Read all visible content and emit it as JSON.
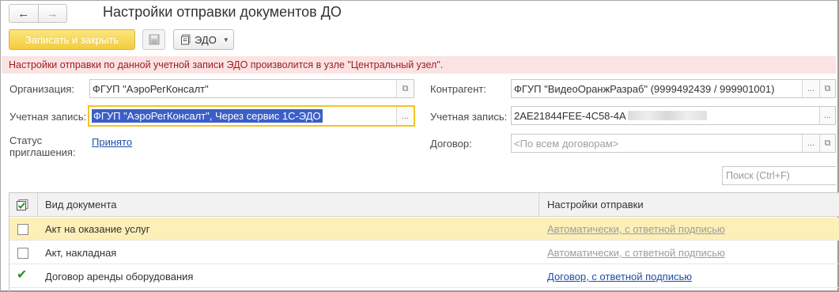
{
  "header": {
    "title": "Настройки отправки документов ДО",
    "nav": {
      "back_icon": "arrow-left-icon",
      "forward_icon": "arrow-right-icon"
    }
  },
  "toolbar": {
    "save_close_label": "Записать и закрыть",
    "save_icon": "floppy-disk-icon",
    "edo_label": "ЭДО",
    "edo_icon": "document-stack-icon"
  },
  "info_message": "Настройки отправки по данной учетной записи ЭДО произволится в узле \"Центральный узел\".",
  "left": {
    "org_label": "Организация:",
    "org_value": "ФГУП \"АэроРегКонсалт\"",
    "account_label": "Учетная запись:",
    "account_value": "ФГУП \"АэроРегКонсалт\", Через сервис 1С-ЭДО",
    "status_label_1": "Статус",
    "status_label_2": "приглашения:",
    "status_value": "Принято"
  },
  "right": {
    "counterparty_label": "Контрагент:",
    "counterparty_value": "ФГУП \"ВидеоОранжРазраб\" (9999492439 / 999901001)",
    "account_label": "Учетная запись:",
    "account_value": "2AE21844FEE-4C58-4A",
    "contract_label": "Договор:",
    "contract_placeholder": "<По всем договорам>"
  },
  "search": {
    "placeholder": "Поиск (Ctrl+F)"
  },
  "table": {
    "header_icon": "check-all-icon",
    "columns": [
      "Вид документа",
      "Настройки отправки"
    ],
    "rows": [
      {
        "checked": false,
        "doc_type": "Акт на оказание услуг",
        "settings": "Автоматически, с ответной подписью",
        "style": "faded"
      },
      {
        "checked": false,
        "doc_type": "Акт, накладная",
        "settings": "Автоматически, с ответной подписью",
        "style": "faded"
      },
      {
        "checked": true,
        "doc_type": "Договор аренды оборудования",
        "settings": "Договор, с ответной подписью",
        "style": "active"
      }
    ]
  },
  "colors": {
    "accent_yellow": "#f2cc3c",
    "info_bg": "#fbe3e3",
    "info_text": "#9b1c1c",
    "link": "#1f4ea3",
    "selection": "#3b5fc7",
    "row_highlight": "#fcefb8"
  }
}
